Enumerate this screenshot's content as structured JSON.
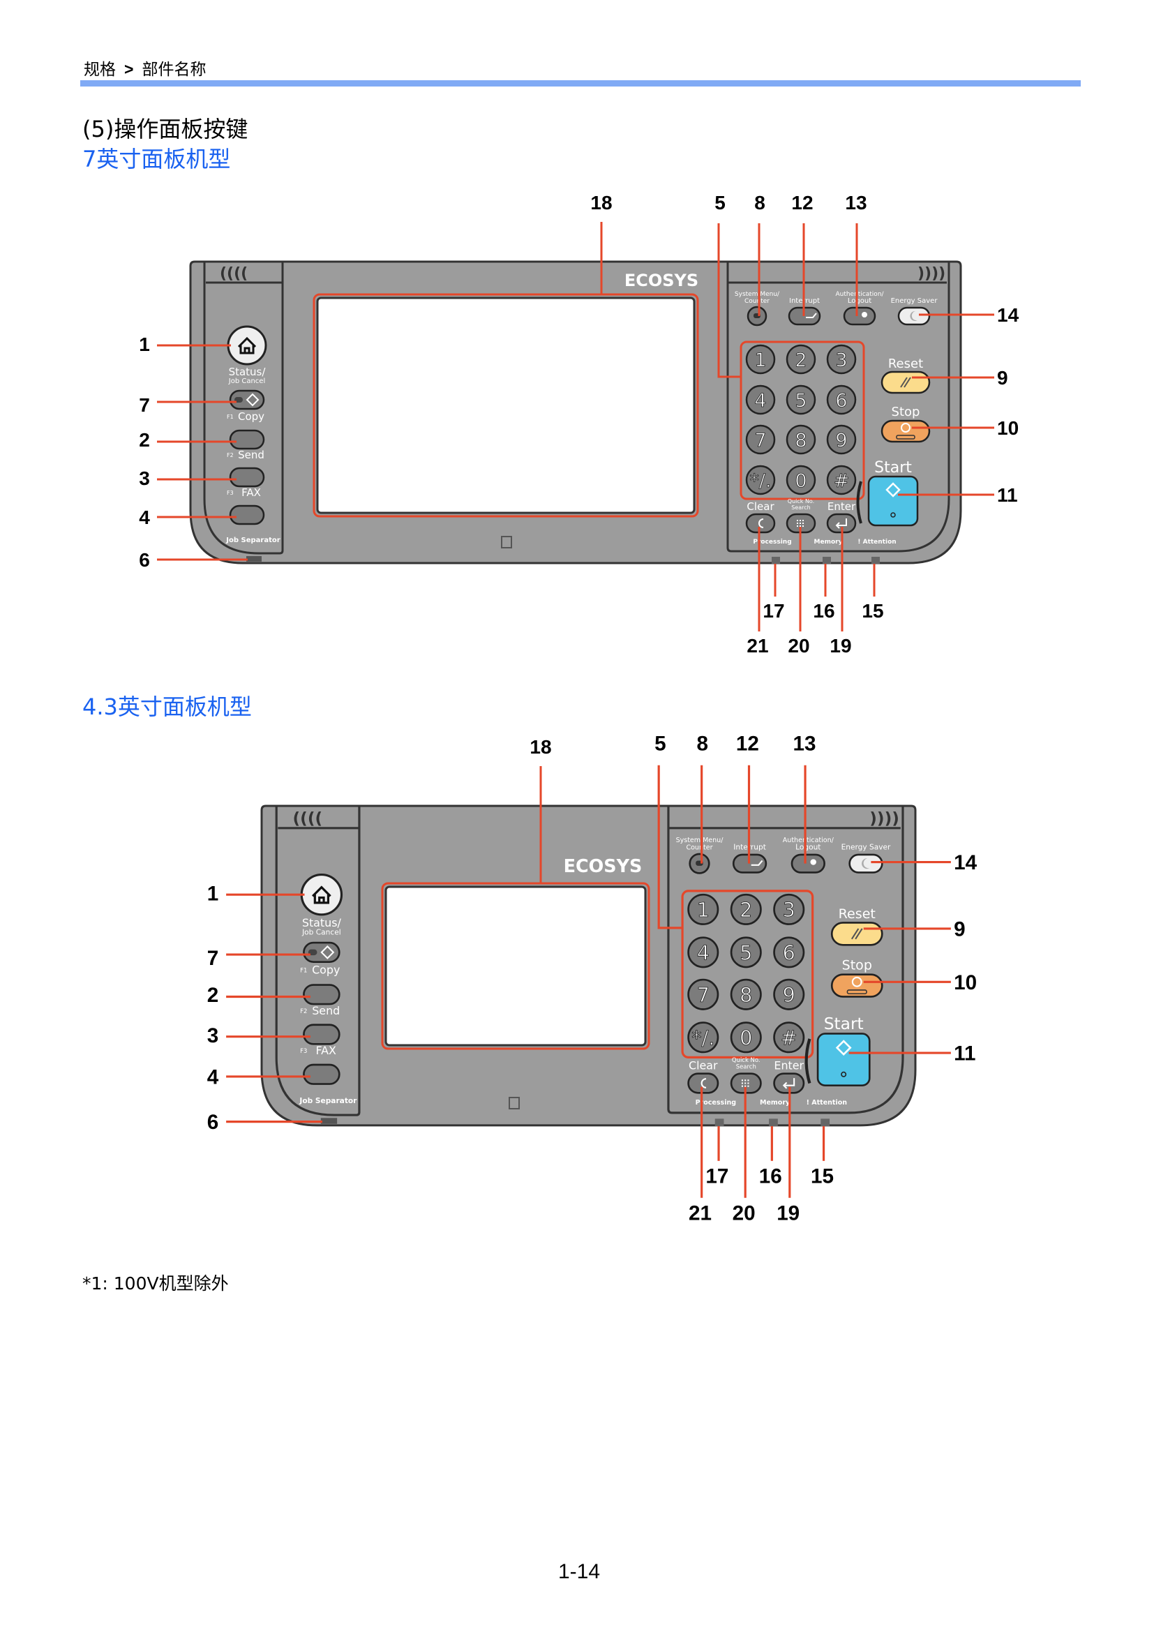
{
  "header": {
    "breadcrumb_parent": "规格",
    "breadcrumb_sep": ">",
    "breadcrumb_current": "部件名称"
  },
  "section_title": "(5)操作面板按键",
  "panels": [
    {
      "title": "7英寸面板机型"
    },
    {
      "title": "4.3英寸面板机型"
    }
  ],
  "callouts": {
    "home": "1",
    "copy": "2",
    "send": "3",
    "fax": "4",
    "numeric_keys": "5",
    "job_separator_led": "6",
    "status_job_cancel": "7",
    "system_menu": "8",
    "reset": "9",
    "stop": "10",
    "start": "11",
    "interrupt": "12",
    "authentication": "13",
    "energy_saver": "14",
    "attention_led": "15",
    "memory_led": "16",
    "processing_led": "17",
    "touch_panel": "18",
    "enter": "19",
    "quick_no_search": "20",
    "clear": "21"
  },
  "panel_labels": {
    "logo": "ECOSYS",
    "status_line1": "Status/",
    "status_line2": "Job Cancel",
    "f1": "F1",
    "copy": "Copy",
    "f2": "F2",
    "send": "Send",
    "f3": "F3",
    "fax": "FAX",
    "job_separator": "Job Separator",
    "system_menu_line1": "System Menu/",
    "system_menu_line2": "Counter",
    "interrupt": "Interrupt",
    "auth_line1": "Authentication/",
    "auth_line2": "Logout",
    "energy_saver": "Energy Saver",
    "reset": "Reset",
    "stop": "Stop",
    "start": "Start",
    "clear": "Clear",
    "quick_line1": "Quick No.",
    "quick_line2": "Search",
    "enter": "Enter",
    "processing": "Processing",
    "memory": "Memory",
    "attention": "! Attention",
    "keys": [
      "1",
      "2",
      "3",
      "4",
      "5",
      "6",
      "7",
      "8",
      "9",
      "*/.",
      "0",
      "#"
    ]
  },
  "colors": {
    "accent_blue": "#1a62f0",
    "header_bar": "#80aaf5",
    "callout_line": "#e5472a",
    "panel_body": "#9c9c9c",
    "reset_button": "#fbdc8c",
    "stop_button": "#f0a35e",
    "start_button": "#4fc3e6"
  },
  "footnote": "*1: 100V机型除外",
  "page_number": "1-14"
}
